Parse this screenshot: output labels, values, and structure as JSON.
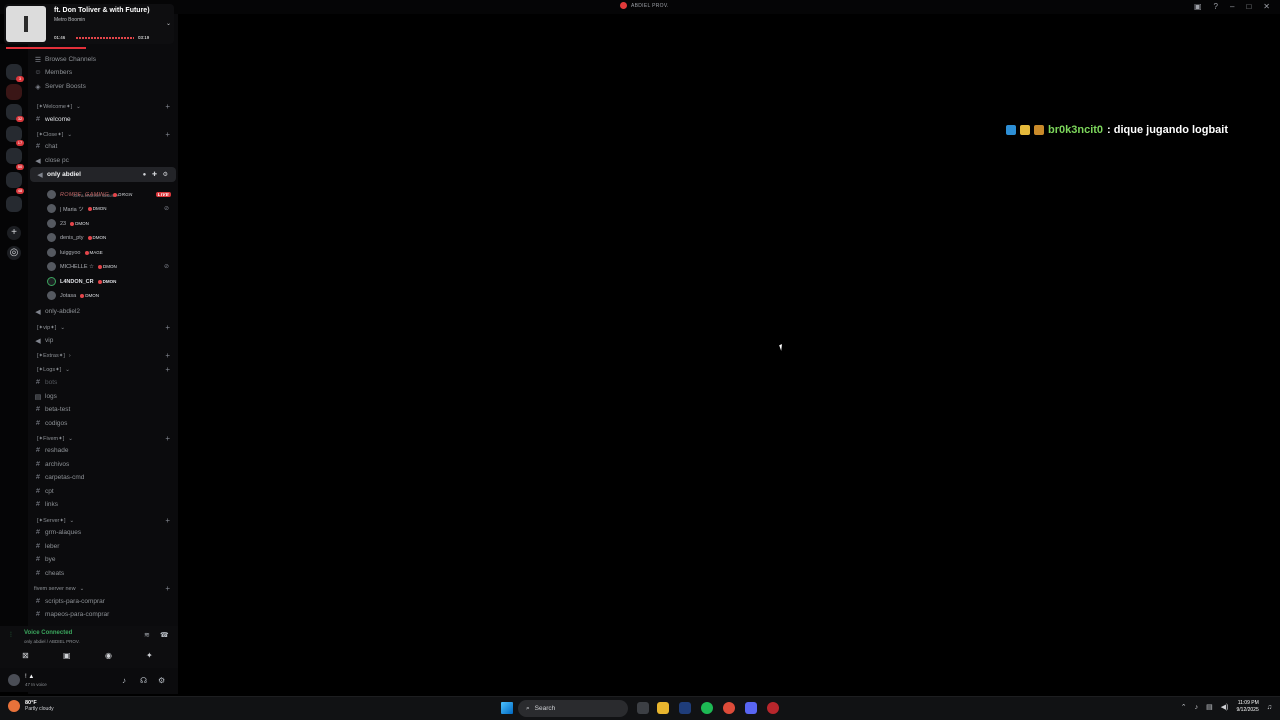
{
  "window": {
    "title": "ABDIEL PROV.",
    "controls": [
      "–",
      "□",
      "✕"
    ]
  },
  "music": {
    "title": "ft. Don Toliver & with Future)",
    "artist": "Metro Boomin",
    "elapsed": "01:46",
    "duration": "03:19",
    "progress": 0.53
  },
  "sidebar": {
    "items": [
      {
        "type": "nav",
        "label": "Browse Channels",
        "icon": "browse-icon"
      },
      {
        "type": "nav",
        "label": "Members",
        "icon": "members-icon"
      },
      {
        "type": "nav",
        "label": "Server Boosts",
        "icon": "boost-icon"
      },
      {
        "type": "cat",
        "label": "[✦Welcome✦]"
      },
      {
        "type": "text",
        "label": "welcome"
      },
      {
        "type": "cat",
        "label": "[✦Close✦]"
      },
      {
        "type": "text",
        "label": "chat"
      },
      {
        "type": "voice",
        "label": "close pc"
      },
      {
        "type": "voice-active",
        "label": "only abdiel",
        "status": "Set a channel status ✎"
      },
      {
        "type": "voice",
        "label": "only-abdiel2"
      },
      {
        "type": "cat",
        "label": "[✦vip✦]"
      },
      {
        "type": "voice",
        "label": "vip"
      },
      {
        "type": "cat",
        "label": "[✦Extras✦]"
      },
      {
        "type": "cat",
        "label": "[✦Logs✦]"
      },
      {
        "type": "text",
        "label": "bots"
      },
      {
        "type": "text",
        "label": "logs"
      },
      {
        "type": "text",
        "label": "beta-test"
      },
      {
        "type": "text",
        "label": "codigos"
      },
      {
        "type": "cat",
        "label": "[✦Fivem✦]"
      },
      {
        "type": "text",
        "label": "reshade"
      },
      {
        "type": "text",
        "label": "archivos"
      },
      {
        "type": "text",
        "label": "carpetas-cmd"
      },
      {
        "type": "text",
        "label": "cpt"
      },
      {
        "type": "text",
        "label": "links"
      },
      {
        "type": "cat",
        "label": "[✦Server✦]"
      },
      {
        "type": "text",
        "label": "grm-alaques"
      },
      {
        "type": "text",
        "label": "leber"
      },
      {
        "type": "text",
        "label": "bye"
      },
      {
        "type": "text",
        "label": "cheats"
      },
      {
        "type": "cat",
        "label": "fivem server new"
      },
      {
        "type": "text",
        "label": "scripts-para-comprar"
      },
      {
        "type": "text",
        "label": "mapeos-para-comprar"
      }
    ],
    "voice_users": [
      {
        "name": "ROMPE_GAMING",
        "tag": "DRGN",
        "live": "LIVE"
      },
      {
        "name": "| Maria ツ",
        "tag": "DMON"
      },
      {
        "name": "23",
        "tag": "DMON"
      },
      {
        "name": "denis_pty",
        "tag": "DMON"
      },
      {
        "name": "luiggyoo",
        "tag": "MAGE"
      },
      {
        "name": "MICHELLE ☆",
        "tag": "DMON"
      },
      {
        "name": "L4NDON_CR",
        "tag": "DMON"
      },
      {
        "name": "Jotasa",
        "tag": "DMON"
      }
    ]
  },
  "voice_panel": {
    "status": "Voice Connected",
    "location": "only abdiel / ABDIEL PROV."
  },
  "user": {
    "name": "! ▲",
    "status": "47 In voice"
  },
  "stage": {
    "chat_user": "br0k3ncit0",
    "chat_text": ": dique jugando logbait"
  },
  "taskbar": {
    "temperature": "80°F",
    "condition": "Partly cloudy",
    "search_placeholder": "Search",
    "time": "11:09 PM",
    "date": "9/12/2025"
  },
  "colors": {
    "accent_red": "#e3303a",
    "voice_green": "#3ba55d",
    "chat_username": "#7cd65b"
  }
}
